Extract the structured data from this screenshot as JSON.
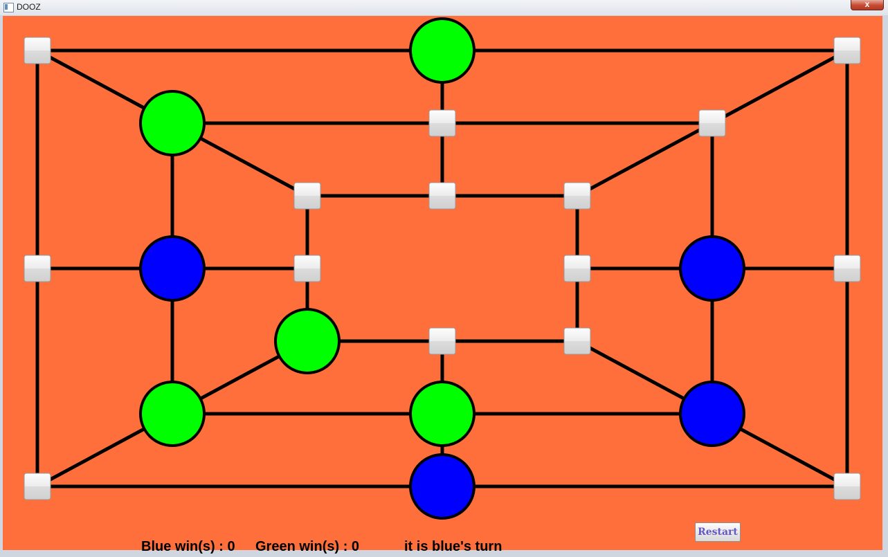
{
  "window": {
    "title": "DOOZ",
    "close_label": "x"
  },
  "colors": {
    "board": "#ff6f3c",
    "line": "#000000",
    "blue": "#0000ff",
    "green": "#00ff00",
    "empty_point": "#f0f0f0",
    "button_text": "#6457c4"
  },
  "board": {
    "rows": [
      "top",
      "upper",
      "inner-top",
      "middle",
      "inner-bottom",
      "lower",
      "bottom"
    ],
    "pieces": {
      "top-center": "green",
      "upper-left": "green",
      "middle-outer-left": "blue",
      "middle-outer-right": "blue",
      "inner-bottom-left": "green",
      "lower-left": "green",
      "lower-center": "green",
      "lower-right": "blue",
      "bottom-center": "blue"
    },
    "empty_points": [
      "top-left",
      "top-right",
      "upper-center",
      "upper-right",
      "inner-top-left",
      "inner-top-center",
      "inner-top-right",
      "middle-left",
      "middle-inner-left",
      "middle-inner-right",
      "middle-right",
      "inner-bottom-center",
      "inner-bottom-right",
      "bottom-left",
      "bottom-right"
    ]
  },
  "score": {
    "blue_label": "Blue win(s) : 0",
    "green_label": "Green win(s) : 0"
  },
  "turn_text": "it is blue's turn",
  "restart_label": "Restart"
}
